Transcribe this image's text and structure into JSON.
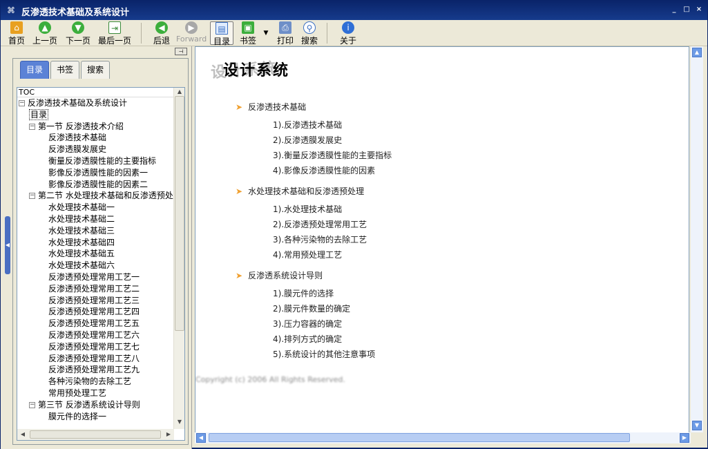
{
  "window": {
    "title": "反渗透技术基础及系统设计",
    "icon": "app-icon",
    "controls": [
      "_",
      "□",
      "×"
    ]
  },
  "toolbar": {
    "home": "首页",
    "prev": "上一页",
    "next": "下一页",
    "last": "最后一页",
    "back": "后退",
    "forward": "Forward",
    "toc": "目录",
    "bookmark": "书签",
    "print": "打印",
    "search": "搜索",
    "about": "关于"
  },
  "left_pane": {
    "pin_glyph": "⊣",
    "tabs": [
      "目录",
      "书签",
      "搜索"
    ],
    "tree_header": "TOC",
    "tree": [
      {
        "level": 0,
        "label": "反渗透技术基础及系统设计",
        "expander": "−"
      },
      {
        "level": 1,
        "label": "目录",
        "selected": true
      },
      {
        "level": 1,
        "label": "第一节 反渗透技术介绍",
        "expander": "−"
      },
      {
        "level": 2,
        "label": "反渗透技术基础"
      },
      {
        "level": 2,
        "label": "反渗透膜发展史"
      },
      {
        "level": 2,
        "label": "衡量反渗透膜性能的主要指标"
      },
      {
        "level": 2,
        "label": "影像反渗透膜性能的因素一"
      },
      {
        "level": 2,
        "label": "影像反渗透膜性能的因素二"
      },
      {
        "level": 1,
        "label": "第二节 水处理技术基础和反渗透预处",
        "expander": "−"
      },
      {
        "level": 2,
        "label": "水处理技术基础一"
      },
      {
        "level": 2,
        "label": "水处理技术基础二"
      },
      {
        "level": 2,
        "label": "水处理技术基础三"
      },
      {
        "level": 2,
        "label": "水处理技术基础四"
      },
      {
        "level": 2,
        "label": "水处理技术基础五"
      },
      {
        "level": 2,
        "label": "水处理技术基础六"
      },
      {
        "level": 2,
        "label": "反渗透预处理常用工艺一"
      },
      {
        "level": 2,
        "label": "反渗透预处理常用工艺二"
      },
      {
        "level": 2,
        "label": "反渗透预处理常用工艺三"
      },
      {
        "level": 2,
        "label": "反渗透预处理常用工艺四"
      },
      {
        "level": 2,
        "label": "反渗透预处理常用工艺五"
      },
      {
        "level": 2,
        "label": "反渗透预处理常用工艺六"
      },
      {
        "level": 2,
        "label": "反渗透预处理常用工艺七"
      },
      {
        "level": 2,
        "label": "反渗透预处理常用工艺八"
      },
      {
        "level": 2,
        "label": "反渗透预处理常用工艺九"
      },
      {
        "level": 2,
        "label": "各种污染物的去除工艺"
      },
      {
        "level": 2,
        "label": "常用预处理工艺"
      },
      {
        "level": 1,
        "label": "第三节 反渗透系统设计导则",
        "expander": "−"
      },
      {
        "level": 2,
        "label": "膜元件的选择一"
      }
    ]
  },
  "content": {
    "title_shadow": "设计系统",
    "title": "设计系统",
    "sections": [
      {
        "heading": "反渗透技术基础",
        "items": [
          "1).反渗透技术基础",
          "2).反渗透膜发展史",
          "3).衡量反渗透膜性能的主要指标",
          "4).影像反渗透膜性能的因素"
        ]
      },
      {
        "heading": "水处理技术基础和反渗透预处理",
        "items": [
          "1).水处理技术基础",
          "2).反渗透预处理常用工艺",
          "3).各种污染物的去除工艺",
          "4).常用预处理工艺"
        ]
      },
      {
        "heading": "反渗透系统设计导则",
        "items": [
          "1).膜元件的选择",
          "2).膜元件数量的确定",
          "3).压力容器的确定",
          "4).排列方式的确定",
          "5).系统设计的其他注意事项"
        ]
      }
    ],
    "copyright": "Copyright (c) 2006 All Rights Reserved."
  }
}
